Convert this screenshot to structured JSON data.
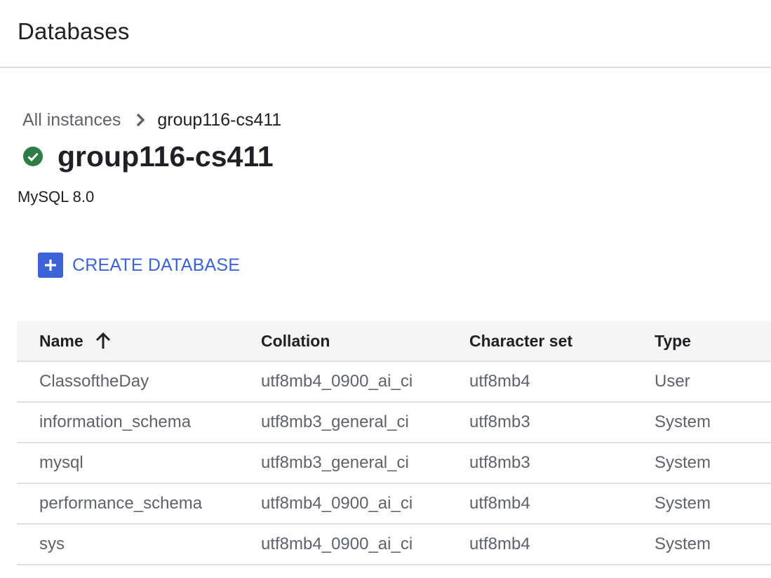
{
  "header": {
    "title": "Databases"
  },
  "breadcrumb": {
    "parent": "All instances",
    "current": "group116-cs411",
    "separator_icon": "chevron-right-icon"
  },
  "instance": {
    "name": "group116-cs411",
    "status_icon": "check-circle-icon",
    "status_color": "#34a853",
    "engine": "MySQL 8.0"
  },
  "actions": {
    "create_label": "CREATE DATABASE",
    "create_icon": "add-box-icon",
    "accent_color": "#3c64d8"
  },
  "table": {
    "columns": [
      "Name",
      "Collation",
      "Character set",
      "Type"
    ],
    "sort": {
      "column": "Name",
      "direction": "ascending",
      "icon": "arrow-up-icon"
    },
    "rows": [
      {
        "name": "ClassoftheDay",
        "collation": "utf8mb4_0900_ai_ci",
        "charset": "utf8mb4",
        "type": "User"
      },
      {
        "name": "information_schema",
        "collation": "utf8mb3_general_ci",
        "charset": "utf8mb3",
        "type": "System"
      },
      {
        "name": "mysql",
        "collation": "utf8mb3_general_ci",
        "charset": "utf8mb3",
        "type": "System"
      },
      {
        "name": "performance_schema",
        "collation": "utf8mb4_0900_ai_ci",
        "charset": "utf8mb4",
        "type": "System"
      },
      {
        "name": "sys",
        "collation": "utf8mb4_0900_ai_ci",
        "charset": "utf8mb4",
        "type": "System"
      }
    ]
  }
}
